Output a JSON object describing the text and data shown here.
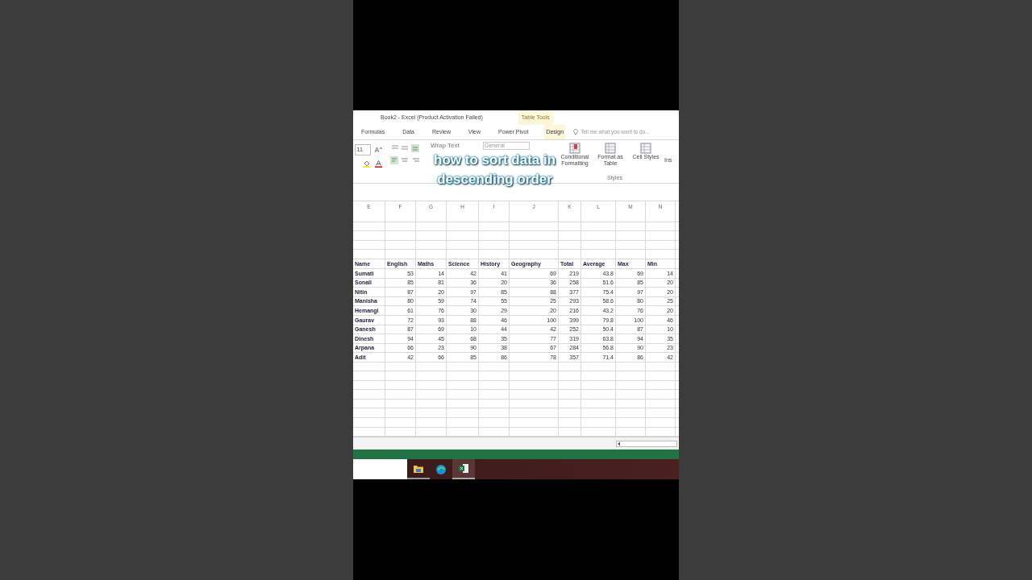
{
  "window": {
    "title": "Book2 - Excel (Product Activation Failed)",
    "context_label": "Table Tools"
  },
  "ribbon_tabs": [
    {
      "label": "Formulas",
      "selected": false
    },
    {
      "label": "Data",
      "selected": false
    },
    {
      "label": "Review",
      "selected": false
    },
    {
      "label": "View",
      "selected": false
    },
    {
      "label": "Power Pivot",
      "selected": false
    },
    {
      "label": "Design",
      "selected": true
    }
  ],
  "tell_me": {
    "placeholder": "Tell me what you want to do..."
  },
  "ribbon": {
    "font_size": "11",
    "wrap_text": "Wrap Text",
    "number_format": "General",
    "styles_buttons": [
      "Conditional Formatting",
      "Format as Table",
      "Cell Styles"
    ],
    "cut_button": "Ins",
    "group_label": "Styles"
  },
  "caption": [
    "how to sort data in",
    "descending order"
  ],
  "sheet": {
    "columns": [
      "E",
      "F",
      "G",
      "H",
      "I",
      "J",
      "K",
      "L",
      "M",
      "N"
    ],
    "header": [
      "Name",
      "English",
      "Maths",
      "Science",
      "History",
      "Geography",
      "Total",
      "Average",
      "Max",
      "Min"
    ],
    "rows": [
      [
        "Sumati",
        "53",
        "14",
        "42",
        "41",
        "69",
        "219",
        "43.8",
        "69",
        "14"
      ],
      [
        "Sonali",
        "85",
        "81",
        "36",
        "20",
        "36",
        "258",
        "51.6",
        "85",
        "20"
      ],
      [
        "Nitin",
        "87",
        "20",
        "97",
        "85",
        "88",
        "377",
        "75.4",
        "97",
        "20"
      ],
      [
        "Manisha",
        "80",
        "59",
        "74",
        "55",
        "25",
        "293",
        "58.6",
        "80",
        "25"
      ],
      [
        "Hemangi",
        "61",
        "76",
        "30",
        "29",
        "20",
        "216",
        "43.2",
        "76",
        "20"
      ],
      [
        "Gaurav",
        "72",
        "93",
        "88",
        "46",
        "100",
        "399",
        "79.8",
        "100",
        "46"
      ],
      [
        "Ganesh",
        "87",
        "69",
        "10",
        "44",
        "42",
        "252",
        "50.4",
        "87",
        "10"
      ],
      [
        "Dinesh",
        "94",
        "45",
        "68",
        "35",
        "77",
        "319",
        "63.8",
        "94",
        "35"
      ],
      [
        "Arpana",
        "66",
        "23",
        "90",
        "38",
        "67",
        "284",
        "56.8",
        "90",
        "23"
      ],
      [
        "Adit",
        "42",
        "66",
        "85",
        "86",
        "78",
        "357",
        "71.4",
        "86",
        "42"
      ]
    ]
  }
}
